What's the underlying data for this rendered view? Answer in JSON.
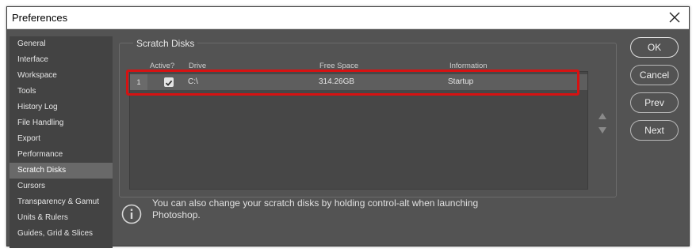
{
  "window": {
    "title": "Preferences"
  },
  "sidebar": {
    "items": [
      {
        "label": "General"
      },
      {
        "label": "Interface"
      },
      {
        "label": "Workspace"
      },
      {
        "label": "Tools"
      },
      {
        "label": "History Log"
      },
      {
        "label": "File Handling"
      },
      {
        "label": "Export"
      },
      {
        "label": "Performance"
      },
      {
        "label": "Scratch Disks",
        "selected": true
      },
      {
        "label": "Cursors"
      },
      {
        "label": "Transparency & Gamut"
      },
      {
        "label": "Units & Rulers"
      },
      {
        "label": "Guides, Grid & Slices"
      }
    ]
  },
  "scratch": {
    "title": "Scratch Disks",
    "columns": {
      "active": "Active?",
      "drive": "Drive",
      "free_space": "Free Space",
      "information": "Information"
    },
    "rows": [
      {
        "num": "1",
        "active": true,
        "drive": "C:\\",
        "free_space": "314.26GB",
        "information": "Startup"
      }
    ]
  },
  "buttons": {
    "ok": "OK",
    "cancel": "Cancel",
    "prev": "Prev",
    "next": "Next"
  },
  "note": "You can also change your scratch disks by holding control-alt when launching Photoshop.",
  "colors": {
    "panel": "#535353",
    "sidebar": "#434343",
    "selected": "#696969",
    "highlight": "#d61212"
  }
}
